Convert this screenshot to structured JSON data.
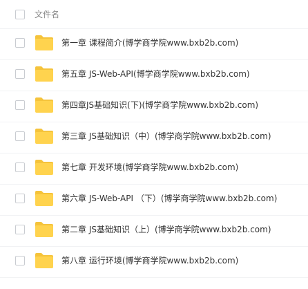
{
  "header": {
    "name_column_label": "文件名"
  },
  "colors": {
    "folder": "#FFD34E",
    "folder_tab": "#F5C33B",
    "divider": "#F1F2F4",
    "checkbox_border": "#C9CCD1"
  },
  "files": [
    {
      "name": "第一章 课程简介(博学商学院www.bxb2b.com)",
      "icon": "folder-icon"
    },
    {
      "name": "第五章 JS-Web-API(博学商学院www.bxb2b.com)",
      "icon": "folder-icon"
    },
    {
      "name": "第四章JS基础知识(下)(博学商学院www.bxb2b.com)",
      "icon": "folder-icon"
    },
    {
      "name": "第三章 JS基础知识（中）(博学商学院www.bxb2b.com)",
      "icon": "folder-icon"
    },
    {
      "name": "第七章 开发环境(博学商学院www.bxb2b.com)",
      "icon": "folder-icon"
    },
    {
      "name": "第六章 JS-Web-API （下）(博学商学院www.bxb2b.com)",
      "icon": "folder-icon"
    },
    {
      "name": "第二章 JS基础知识（上）(博学商学院www.bxb2b.com)",
      "icon": "folder-icon"
    },
    {
      "name": "第八章 运行环境(博学商学院www.bxb2b.com)",
      "icon": "folder-icon"
    }
  ]
}
